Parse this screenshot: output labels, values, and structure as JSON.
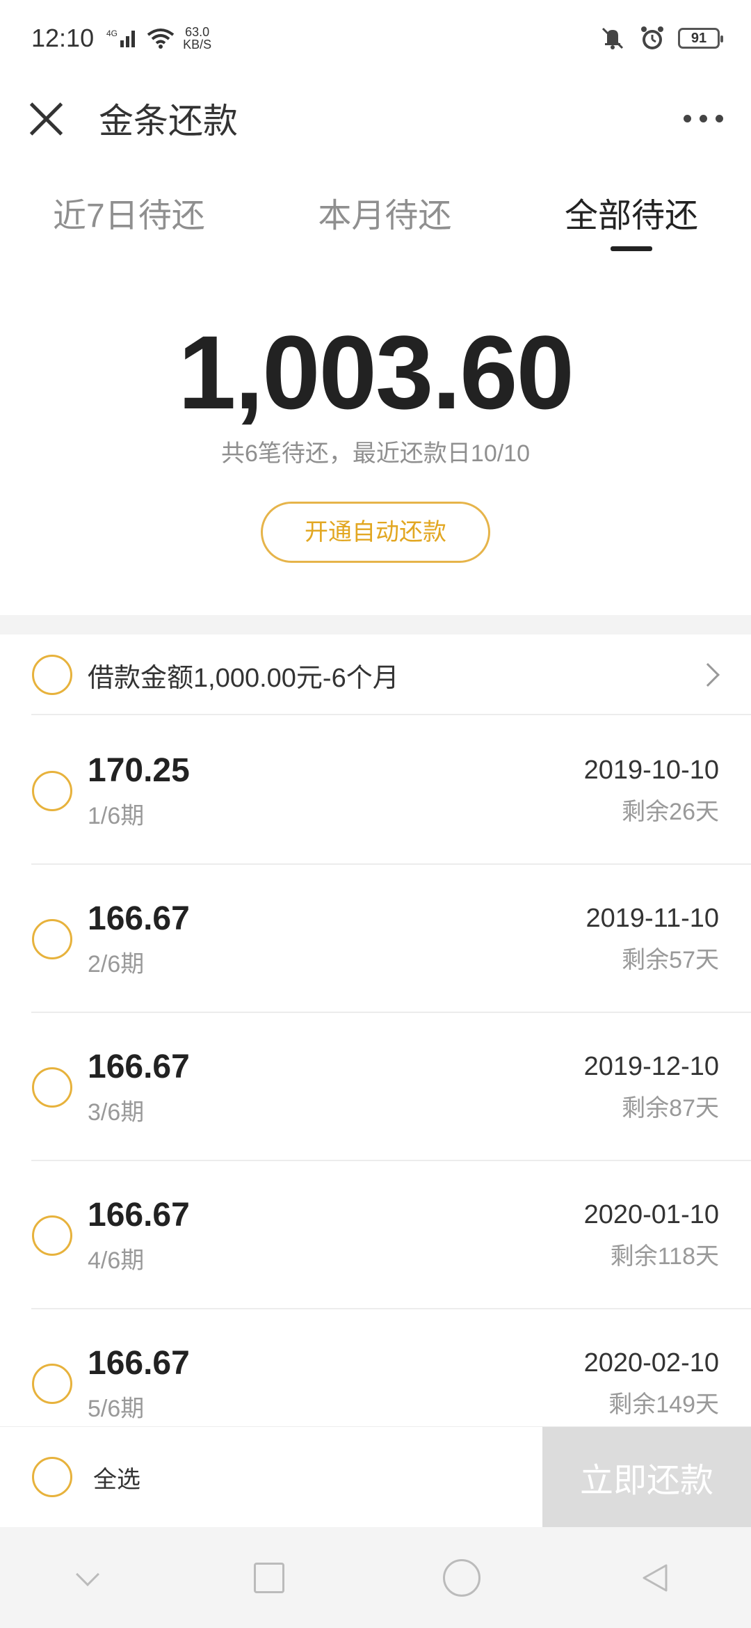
{
  "status_bar": {
    "time": "12:10",
    "network": "4G",
    "speed_value": "63.0",
    "speed_unit": "KB/S",
    "battery": "91"
  },
  "header": {
    "title": "金条还款"
  },
  "tabs": [
    {
      "label": "近7日待还",
      "active": false
    },
    {
      "label": "本月待还",
      "active": false
    },
    {
      "label": "全部待还",
      "active": true
    }
  ],
  "summary": {
    "total": "1,003.60",
    "subtitle": "共6笔待还，最近还款日10/10",
    "auto_repay_label": "开通自动还款"
  },
  "loan": {
    "title": "借款金额1,000.00元-6个月",
    "installments": [
      {
        "amount": "170.25",
        "period": "1/6期",
        "date": "2019-10-10",
        "remaining": "剩余26天"
      },
      {
        "amount": "166.67",
        "period": "2/6期",
        "date": "2019-11-10",
        "remaining": "剩余57天"
      },
      {
        "amount": "166.67",
        "period": "3/6期",
        "date": "2019-12-10",
        "remaining": "剩余87天"
      },
      {
        "amount": "166.67",
        "period": "4/6期",
        "date": "2020-01-10",
        "remaining": "剩余118天"
      },
      {
        "amount": "166.67",
        "period": "5/6期",
        "date": "2020-02-10",
        "remaining": "剩余149天"
      }
    ]
  },
  "action_bar": {
    "select_all_label": "全选",
    "pay_now_label": "立即还款"
  },
  "colors": {
    "accent": "#e7b23c",
    "disabled_button": "#dcdcdc"
  }
}
